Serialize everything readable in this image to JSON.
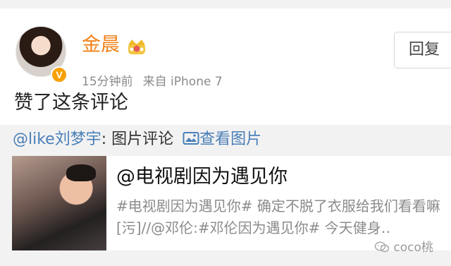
{
  "colors": {
    "username": "#f08018",
    "link": "#4a7fb8",
    "muted": "#8b8b8b",
    "badge": "#f7a000"
  },
  "post": {
    "username": "金晨",
    "time": "15分钟前",
    "source": "来自 iPhone 7",
    "action_text": "赞了这条评论",
    "reply_label": "回复",
    "verified_mark": "V"
  },
  "repost": {
    "user": "@like刘梦宇",
    "comment_type": ": 图片评论",
    "view_label": "查看图片",
    "content": {
      "title": "@电视剧因为遇见你",
      "text": "#电视剧因为遇见你# 确定不脱了衣服给我们看看嘛[污]//@邓伦:#邓伦因为遇见你# 今天健身‥"
    }
  },
  "watermark": {
    "label": "coco桃"
  }
}
